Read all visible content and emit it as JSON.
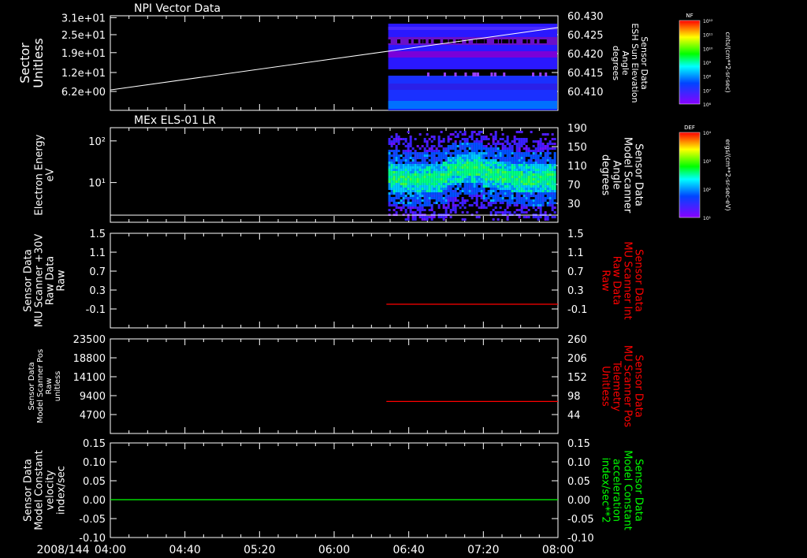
{
  "footer": {
    "date_label": "2008/144"
  },
  "time_axis": {
    "start_min": 240,
    "end_min": 480,
    "ticks": [
      {
        "min": 240,
        "label": "04:00"
      },
      {
        "min": 280,
        "label": "04:40"
      },
      {
        "min": 320,
        "label": "05:20"
      },
      {
        "min": 360,
        "label": "06:00"
      },
      {
        "min": 400,
        "label": "06:40"
      },
      {
        "min": 440,
        "label": "07:20"
      },
      {
        "min": 480,
        "label": "08:00"
      }
    ]
  },
  "colorbars": [
    {
      "title": "NF",
      "unit": "cnts/(cm**2-sr-sec)",
      "ticks": [
        "10¹²",
        "10¹¹",
        "10¹⁰",
        "10⁹",
        "10⁸",
        "10⁷",
        "10⁶"
      ]
    },
    {
      "title": "DEF",
      "unit": "ergs/(cm**2-sr-sec-eV)",
      "ticks": [
        "10⁴",
        "10³",
        "10²",
        "10¹"
      ]
    }
  ],
  "chart_data": [
    {
      "type": "heatmap",
      "title": "NPI Vector Data",
      "ylabel_left": [
        "Sector",
        "Unitless"
      ],
      "yticks_left": [
        "3.1e+01",
        "2.5e+01",
        "1.9e+01",
        "1.2e+01",
        "6.2e+00"
      ],
      "ylabel_right": [
        "Sensor Data",
        "ESH Sun Elevation",
        "Angle",
        "degrees"
      ],
      "yticks_right": [
        "60.430",
        "60.425",
        "60.420",
        "60.415",
        "60.410"
      ],
      "data_start_min": 389,
      "line_series": {
        "x": [
          240,
          480
        ],
        "y": [
          60.4055,
          60.4261
        ],
        "color": "#ffffff"
      },
      "bands": [
        {
          "sector_range": [
            16,
            31
          ],
          "level": "high"
        },
        {
          "sector_range": [
            0,
            11
          ],
          "level": "mid"
        }
      ]
    },
    {
      "type": "heatmap",
      "title": "MEx ELS-01 LR",
      "ylabel_left": [
        "Electron Energy",
        "eV"
      ],
      "yticks_left": [
        "10²",
        "10¹"
      ],
      "ylabel_right": [
        "Sensor Data",
        "Model Scanner",
        "Angle",
        "degrees"
      ],
      "yticks_right": [
        "190",
        "150",
        "110",
        "70",
        "30"
      ],
      "data_start_min": 389,
      "line_series": {
        "x": [
          240,
          480
        ],
        "y": [
          10,
          10
        ],
        "color": "#ffffff"
      }
    },
    {
      "type": "line",
      "title": "",
      "ylabel_left": [
        "Sensor Data",
        "MU Scanner +30V",
        "Raw Data",
        "Raw"
      ],
      "yticks_left": [
        "1.5",
        "1.1",
        "0.7",
        "0.3",
        "-0.1"
      ],
      "ylabel_right": [
        "Sensor Data",
        "MU Scanner Int",
        "Raw Data",
        "Raw"
      ],
      "yticks_right": [
        "1.5",
        "1.1",
        "0.7",
        "0.3",
        "-0.1"
      ],
      "ylim": [
        -0.3,
        1.5
      ],
      "series": [
        {
          "x": [
            388,
            480
          ],
          "y": [
            0,
            0
          ],
          "color": "#ff0000"
        }
      ],
      "right_label_color": "#ff0000"
    },
    {
      "type": "line",
      "title": "",
      "ylabel_left": [
        "Sensor Data",
        "Model Scanner Pos",
        "Raw",
        "unitless"
      ],
      "yticks_left": [
        "23500",
        "18800",
        "14100",
        "9400",
        "4700"
      ],
      "ylabel_right": [
        "Sensor Data",
        "MU Scanner Pos",
        "Telemetry",
        "Unitless"
      ],
      "yticks_right": [
        "260",
        "206",
        "152",
        "98",
        "44"
      ],
      "ylim": [
        0,
        23500
      ],
      "series": [
        {
          "x": [
            388,
            480
          ],
          "y": [
            7950,
            7950
          ],
          "color": "#ff0000"
        }
      ],
      "right_label_color": "#ff0000"
    },
    {
      "type": "line",
      "title": "",
      "ylabel_left": [
        "Sensor Data",
        "Model Constant",
        "velocity",
        "index/sec"
      ],
      "yticks_left": [
        "0.15",
        "0.10",
        "0.05",
        "0.00",
        "-0.05",
        "-0.10"
      ],
      "ylabel_right": [
        "Sensor Data",
        "Model Constant",
        "acceleration",
        "index/sec**2"
      ],
      "yticks_right": [
        "0.15",
        "0.10",
        "0.05",
        "0.00",
        "-0.05",
        "-0.10"
      ],
      "ylim": [
        -0.1,
        0.15
      ],
      "series": [
        {
          "x": [
            240,
            480
          ],
          "y": [
            0,
            0
          ],
          "color": "#00ff00"
        }
      ],
      "right_label_color": "#00ff00"
    }
  ]
}
